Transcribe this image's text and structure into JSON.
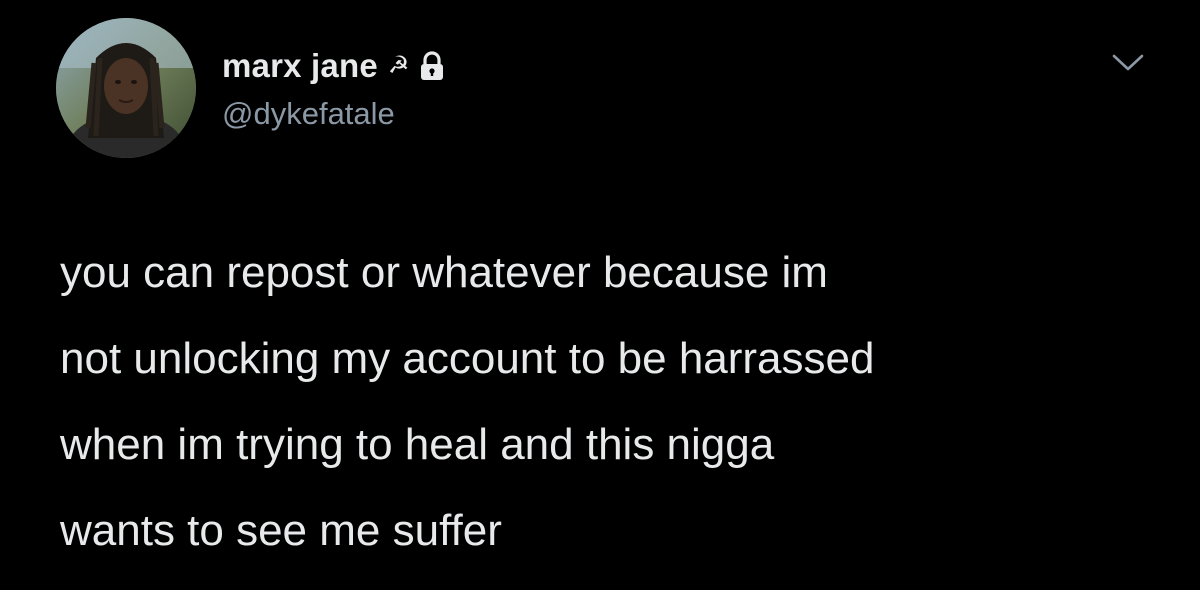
{
  "tweet": {
    "author": {
      "display_name": "marx jane",
      "name_emoji": "☭",
      "handle": "@dykefatale",
      "protected_icon": "lock-icon",
      "avatar_icon": "avatar"
    },
    "menu_icon": "chevron-down-icon",
    "text_lines": [
      "you can repost or whatever because im",
      "not unlocking my account to be harrassed",
      "when im trying to heal and this nigga",
      "wants to see me suffer"
    ]
  },
  "colors": {
    "background": "#000000",
    "primary_text": "#e7e9ea",
    "secondary_text": "#8b98a5"
  }
}
